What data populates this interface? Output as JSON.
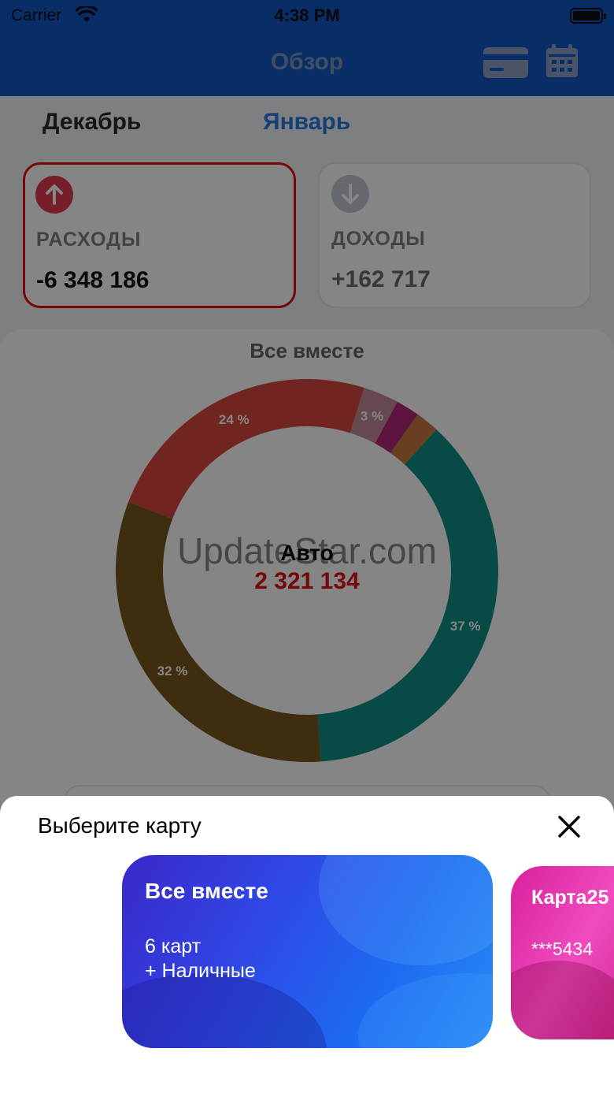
{
  "status_bar": {
    "carrier": "Carrier",
    "time": "4:38 PM"
  },
  "nav": {
    "title": "Обзор",
    "card_icon": "credit-card-icon",
    "calendar_icon": "calendar-icon"
  },
  "months": {
    "previous": "Декабрь",
    "current": "Январь"
  },
  "summary": {
    "expenses": {
      "label": "РАСХОДЫ",
      "value": "-6 348 186",
      "icon": "arrow-up-icon",
      "color": "#e23b52"
    },
    "income": {
      "label": "ДОХОДЫ",
      "value": "+162 717",
      "icon": "arrow-down-icon",
      "color": "#c2c8cf"
    }
  },
  "chart_data": {
    "type": "pie",
    "title": "Все вместе",
    "donut": true,
    "center_label": "Авто",
    "center_value": "2 321 134",
    "slices": [
      {
        "label": "24 %",
        "percent": 24,
        "color": "#d9473f"
      },
      {
        "label": "3 %",
        "percent": 3,
        "color": "#c48a98"
      },
      {
        "label": "",
        "percent": 2,
        "color": "#b22a7c"
      },
      {
        "label": "",
        "percent": 2,
        "color": "#c87a3e"
      },
      {
        "label": "37 %",
        "percent": 37,
        "color": "#0f8f86"
      },
      {
        "label": "32 %",
        "percent": 32,
        "color": "#7a5620"
      }
    ]
  },
  "watermark": "UpdateStar.com",
  "sheet": {
    "title": "Выберите карту",
    "close_icon": "close-icon",
    "cards": [
      {
        "name": "Все вместе",
        "line1": "6 карт",
        "line2": "+ Наличные"
      },
      {
        "name": "Карта25",
        "line1": "***5434"
      }
    ]
  }
}
